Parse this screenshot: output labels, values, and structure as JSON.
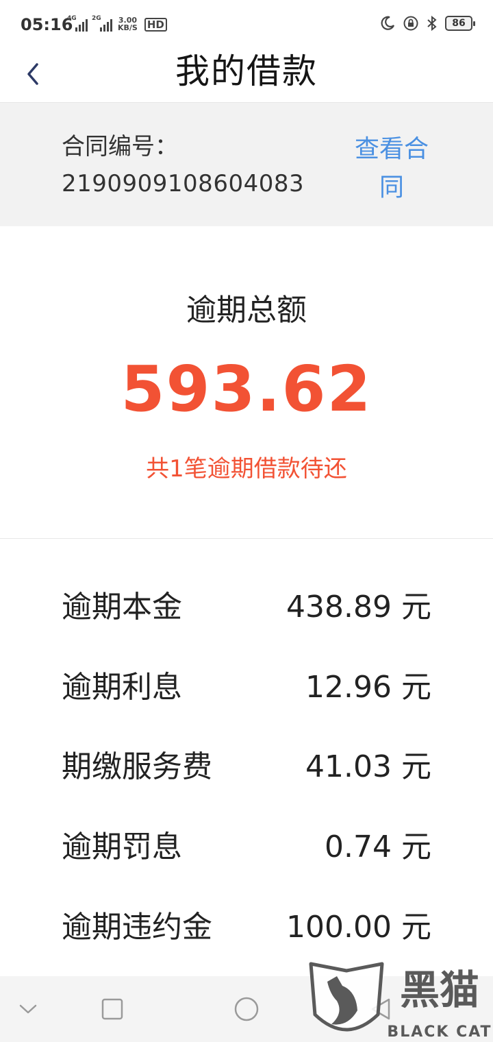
{
  "status_bar": {
    "time": "05:16",
    "signal1_label": "4G",
    "signal2_label": "2G",
    "speed_value": "3.00",
    "speed_unit": "KB/S",
    "hd_label": "HD",
    "battery_level": "86"
  },
  "header": {
    "title": "我的借款"
  },
  "contract": {
    "label": "合同编号：",
    "number": "2190909108604083",
    "view_link_line1": "查看合",
    "view_link_line2": "同"
  },
  "summary": {
    "label": "逾期总额",
    "amount": "593.62",
    "note": "共1笔逾期借款待还"
  },
  "details": [
    {
      "label": "逾期本金",
      "value": "438.89 元"
    },
    {
      "label": "逾期利息",
      "value": "12.96 元"
    },
    {
      "label": "期缴服务费",
      "value": "41.03 元"
    },
    {
      "label": "逾期罚息",
      "value": "0.74 元"
    },
    {
      "label": "逾期违约金",
      "value": "100.00 元"
    }
  ],
  "watermark": {
    "text_cn": "黑猫",
    "text_en": "BLACK CAT"
  },
  "colors": {
    "accent_red": "#f25234",
    "link_blue": "#4a90e2"
  }
}
